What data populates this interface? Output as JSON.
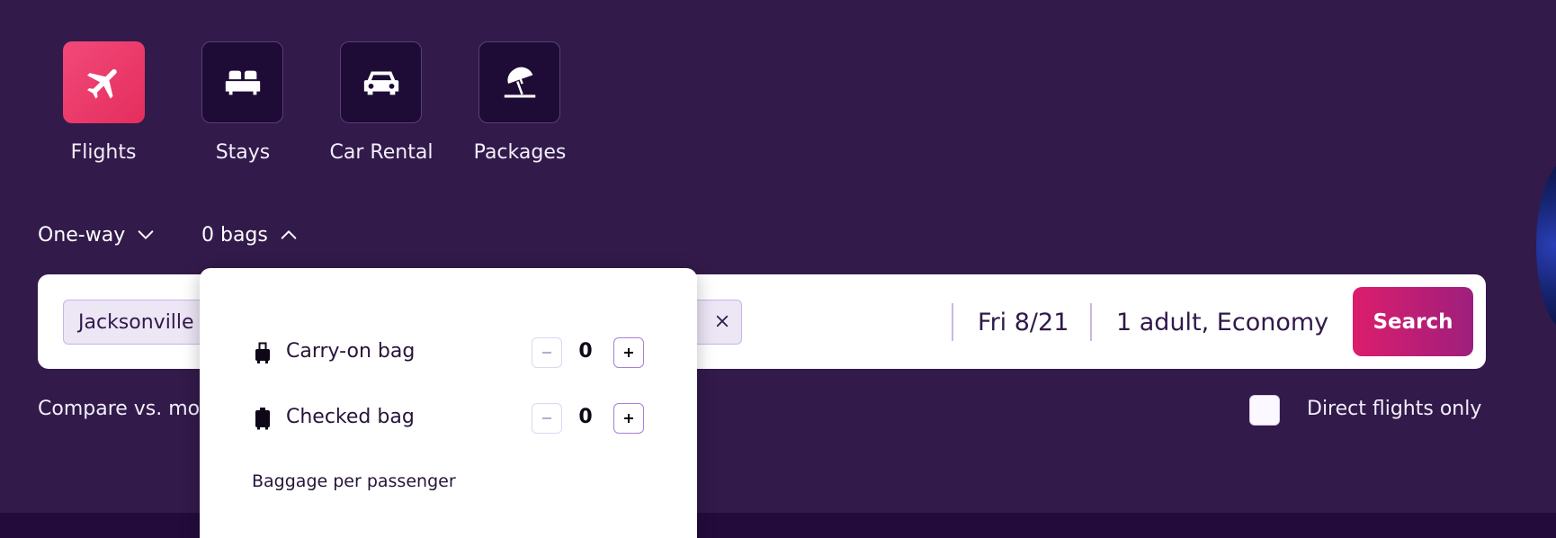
{
  "products": [
    {
      "label": "Flights",
      "icon": "plane-icon",
      "active": true
    },
    {
      "label": "Stays",
      "icon": "bed-icon",
      "active": false
    },
    {
      "label": "Car Rental",
      "icon": "car-icon",
      "active": false
    },
    {
      "label": "Packages",
      "icon": "beach-umbrella-icon",
      "active": false
    }
  ],
  "trip_type": {
    "label": "One-way",
    "icon": "chevron-down-icon"
  },
  "bags": {
    "label": "0 bags",
    "icon": "chevron-up-icon",
    "expanded": true
  },
  "search": {
    "origin": "Jacksonville",
    "date": "Fri 8/21",
    "travelers": "1 adult, Economy",
    "button_label": "Search"
  },
  "compare_text": "Compare vs. mo",
  "direct_flights": {
    "label": "Direct flights only",
    "checked": false
  },
  "bags_popover": {
    "carry_on": {
      "label": "Carry-on bag",
      "value": "0",
      "icon": "carry-on-bag-icon"
    },
    "checked": {
      "label": "Checked bag",
      "value": "0",
      "icon": "checked-bag-icon"
    },
    "note": "Baggage per passenger"
  },
  "colors": {
    "background": "#321a4a",
    "active_tile": "#e42e5d",
    "search_button": "#dc1d6c",
    "text_dark": "#30194a"
  }
}
